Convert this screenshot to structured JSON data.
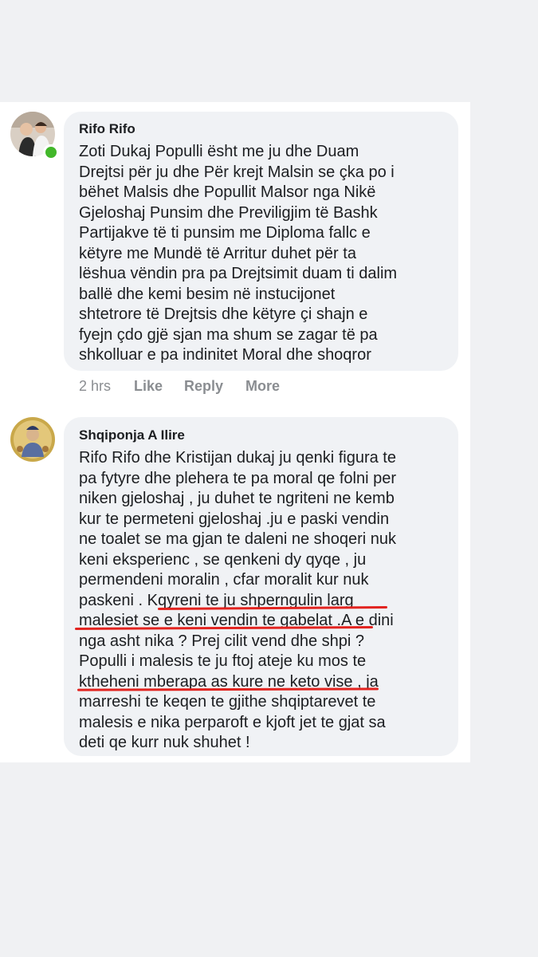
{
  "comments": [
    {
      "author": "Rifo Rifo",
      "online": true,
      "lines": [
        "Zoti Dukaj Populli ësht me ju dhe Duam",
        "Drejtsi për ju dhe Për krejt Malsin se çka po i",
        "bëhet Malsis dhe Popullit Malsor nga Nikë",
        "Gjeloshaj Punsim dhe Previligjim të Bashk",
        "Partijakve të ti punsim me Diploma fallc e",
        "këtyre me Mundë të Arritur duhet për ta",
        "lëshua vëndin pra pa Drejtsimit duam ti dalim",
        "ballë dhe kemi besim në instucijonet",
        "shtetrore të Drejtsis dhe këtyre çi shajn e",
        "fyejn çdo gjë sjan ma shum se zagar të pa",
        "shkolluar e pa indinitet Moral dhe shoqror"
      ],
      "time": "2 hrs",
      "like": "Like",
      "reply": "Reply",
      "more": "More"
    },
    {
      "author": "Shqiponja A Ilire",
      "online": false,
      "lines": [
        "Rifo Rifo dhe Kristijan dukaj ju qenki figura te",
        "pa fytyre dhe plehera te pa moral qe folni per",
        "niken gjeloshaj , ju duhet te ngriteni ne kemb",
        "kur te permeteni gjeloshaj .ju e paski vendin",
        "ne toalet se ma gjan te daleni ne shoqeri nuk",
        "keni eksperienc , se qenkeni dy qyqe , ju",
        "permendeni moralin , cfar moralit kur nuk",
        "paskeni . Kqyreni te ju shperngulin larg",
        "malesiet se e keni vendin te gabelat .A e dini",
        "nga asht nika ? Prej cilit vend dhe shpi ?",
        "Populli i malesis te ju ftoj ateje ku mos te",
        "ktheheni mberapa as kure ne keto vise , ja",
        "marreshi te keqen te gjithe shqiptarevet te",
        "malesis e nika perparoft e kjoft jet te gjat sa",
        "deti qe kurr nuk shuhet !"
      ]
    }
  ],
  "colors": {
    "bubble": "#f0f2f5",
    "underline": "#e2231f",
    "online": "#42b72a",
    "meta": "#8a8d91"
  }
}
